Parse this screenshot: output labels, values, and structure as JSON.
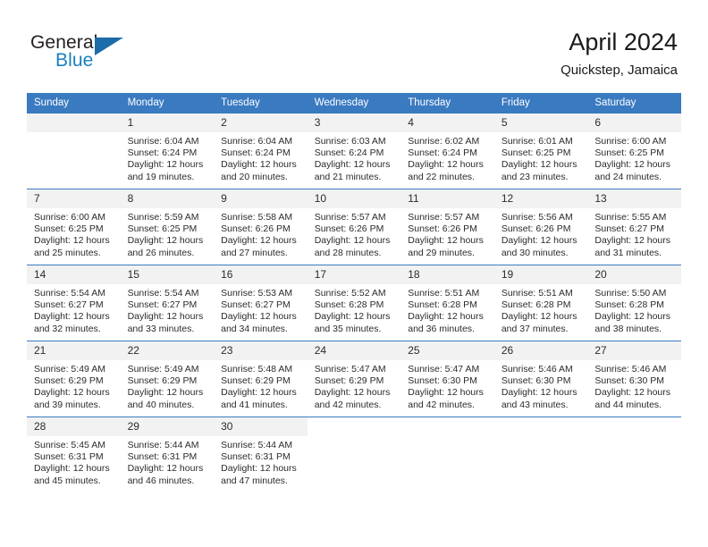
{
  "brand": {
    "line1": "General",
    "line2": "Blue",
    "accent_color": "#1b6ca8",
    "text_color": "#231f20"
  },
  "header": {
    "title": "April 2024",
    "subtitle": "Quickstep, Jamaica"
  },
  "calendar": {
    "header_bg": "#3a7ac0",
    "header_text": "#ffffff",
    "day_band_bg": "#f2f2f2",
    "weekdays": [
      "Sunday",
      "Monday",
      "Tuesday",
      "Wednesday",
      "Thursday",
      "Friday",
      "Saturday"
    ],
    "weeks": [
      [
        {
          "day": "",
          "sunrise": "",
          "sunset": "",
          "daylight1": "",
          "daylight2": "",
          "blank": true
        },
        {
          "day": "1",
          "sunrise": "Sunrise: 6:04 AM",
          "sunset": "Sunset: 6:24 PM",
          "daylight1": "Daylight: 12 hours",
          "daylight2": "and 19 minutes."
        },
        {
          "day": "2",
          "sunrise": "Sunrise: 6:04 AM",
          "sunset": "Sunset: 6:24 PM",
          "daylight1": "Daylight: 12 hours",
          "daylight2": "and 20 minutes."
        },
        {
          "day": "3",
          "sunrise": "Sunrise: 6:03 AM",
          "sunset": "Sunset: 6:24 PM",
          "daylight1": "Daylight: 12 hours",
          "daylight2": "and 21 minutes."
        },
        {
          "day": "4",
          "sunrise": "Sunrise: 6:02 AM",
          "sunset": "Sunset: 6:24 PM",
          "daylight1": "Daylight: 12 hours",
          "daylight2": "and 22 minutes."
        },
        {
          "day": "5",
          "sunrise": "Sunrise: 6:01 AM",
          "sunset": "Sunset: 6:25 PM",
          "daylight1": "Daylight: 12 hours",
          "daylight2": "and 23 minutes."
        },
        {
          "day": "6",
          "sunrise": "Sunrise: 6:00 AM",
          "sunset": "Sunset: 6:25 PM",
          "daylight1": "Daylight: 12 hours",
          "daylight2": "and 24 minutes."
        }
      ],
      [
        {
          "day": "7",
          "sunrise": "Sunrise: 6:00 AM",
          "sunset": "Sunset: 6:25 PM",
          "daylight1": "Daylight: 12 hours",
          "daylight2": "and 25 minutes."
        },
        {
          "day": "8",
          "sunrise": "Sunrise: 5:59 AM",
          "sunset": "Sunset: 6:25 PM",
          "daylight1": "Daylight: 12 hours",
          "daylight2": "and 26 minutes."
        },
        {
          "day": "9",
          "sunrise": "Sunrise: 5:58 AM",
          "sunset": "Sunset: 6:26 PM",
          "daylight1": "Daylight: 12 hours",
          "daylight2": "and 27 minutes."
        },
        {
          "day": "10",
          "sunrise": "Sunrise: 5:57 AM",
          "sunset": "Sunset: 6:26 PM",
          "daylight1": "Daylight: 12 hours",
          "daylight2": "and 28 minutes."
        },
        {
          "day": "11",
          "sunrise": "Sunrise: 5:57 AM",
          "sunset": "Sunset: 6:26 PM",
          "daylight1": "Daylight: 12 hours",
          "daylight2": "and 29 minutes."
        },
        {
          "day": "12",
          "sunrise": "Sunrise: 5:56 AM",
          "sunset": "Sunset: 6:26 PM",
          "daylight1": "Daylight: 12 hours",
          "daylight2": "and 30 minutes."
        },
        {
          "day": "13",
          "sunrise": "Sunrise: 5:55 AM",
          "sunset": "Sunset: 6:27 PM",
          "daylight1": "Daylight: 12 hours",
          "daylight2": "and 31 minutes."
        }
      ],
      [
        {
          "day": "14",
          "sunrise": "Sunrise: 5:54 AM",
          "sunset": "Sunset: 6:27 PM",
          "daylight1": "Daylight: 12 hours",
          "daylight2": "and 32 minutes."
        },
        {
          "day": "15",
          "sunrise": "Sunrise: 5:54 AM",
          "sunset": "Sunset: 6:27 PM",
          "daylight1": "Daylight: 12 hours",
          "daylight2": "and 33 minutes."
        },
        {
          "day": "16",
          "sunrise": "Sunrise: 5:53 AM",
          "sunset": "Sunset: 6:27 PM",
          "daylight1": "Daylight: 12 hours",
          "daylight2": "and 34 minutes."
        },
        {
          "day": "17",
          "sunrise": "Sunrise: 5:52 AM",
          "sunset": "Sunset: 6:28 PM",
          "daylight1": "Daylight: 12 hours",
          "daylight2": "and 35 minutes."
        },
        {
          "day": "18",
          "sunrise": "Sunrise: 5:51 AM",
          "sunset": "Sunset: 6:28 PM",
          "daylight1": "Daylight: 12 hours",
          "daylight2": "and 36 minutes."
        },
        {
          "day": "19",
          "sunrise": "Sunrise: 5:51 AM",
          "sunset": "Sunset: 6:28 PM",
          "daylight1": "Daylight: 12 hours",
          "daylight2": "and 37 minutes."
        },
        {
          "day": "20",
          "sunrise": "Sunrise: 5:50 AM",
          "sunset": "Sunset: 6:28 PM",
          "daylight1": "Daylight: 12 hours",
          "daylight2": "and 38 minutes."
        }
      ],
      [
        {
          "day": "21",
          "sunrise": "Sunrise: 5:49 AM",
          "sunset": "Sunset: 6:29 PM",
          "daylight1": "Daylight: 12 hours",
          "daylight2": "and 39 minutes."
        },
        {
          "day": "22",
          "sunrise": "Sunrise: 5:49 AM",
          "sunset": "Sunset: 6:29 PM",
          "daylight1": "Daylight: 12 hours",
          "daylight2": "and 40 minutes."
        },
        {
          "day": "23",
          "sunrise": "Sunrise: 5:48 AM",
          "sunset": "Sunset: 6:29 PM",
          "daylight1": "Daylight: 12 hours",
          "daylight2": "and 41 minutes."
        },
        {
          "day": "24",
          "sunrise": "Sunrise: 5:47 AM",
          "sunset": "Sunset: 6:29 PM",
          "daylight1": "Daylight: 12 hours",
          "daylight2": "and 42 minutes."
        },
        {
          "day": "25",
          "sunrise": "Sunrise: 5:47 AM",
          "sunset": "Sunset: 6:30 PM",
          "daylight1": "Daylight: 12 hours",
          "daylight2": "and 42 minutes."
        },
        {
          "day": "26",
          "sunrise": "Sunrise: 5:46 AM",
          "sunset": "Sunset: 6:30 PM",
          "daylight1": "Daylight: 12 hours",
          "daylight2": "and 43 minutes."
        },
        {
          "day": "27",
          "sunrise": "Sunrise: 5:46 AM",
          "sunset": "Sunset: 6:30 PM",
          "daylight1": "Daylight: 12 hours",
          "daylight2": "and 44 minutes."
        }
      ],
      [
        {
          "day": "28",
          "sunrise": "Sunrise: 5:45 AM",
          "sunset": "Sunset: 6:31 PM",
          "daylight1": "Daylight: 12 hours",
          "daylight2": "and 45 minutes."
        },
        {
          "day": "29",
          "sunrise": "Sunrise: 5:44 AM",
          "sunset": "Sunset: 6:31 PM",
          "daylight1": "Daylight: 12 hours",
          "daylight2": "and 46 minutes."
        },
        {
          "day": "30",
          "sunrise": "Sunrise: 5:44 AM",
          "sunset": "Sunset: 6:31 PM",
          "daylight1": "Daylight: 12 hours",
          "daylight2": "and 47 minutes."
        },
        {
          "day": "",
          "sunrise": "",
          "sunset": "",
          "daylight1": "",
          "daylight2": "",
          "empty": true
        },
        {
          "day": "",
          "sunrise": "",
          "sunset": "",
          "daylight1": "",
          "daylight2": "",
          "empty": true
        },
        {
          "day": "",
          "sunrise": "",
          "sunset": "",
          "daylight1": "",
          "daylight2": "",
          "empty": true
        },
        {
          "day": "",
          "sunrise": "",
          "sunset": "",
          "daylight1": "",
          "daylight2": "",
          "empty": true
        }
      ]
    ]
  }
}
